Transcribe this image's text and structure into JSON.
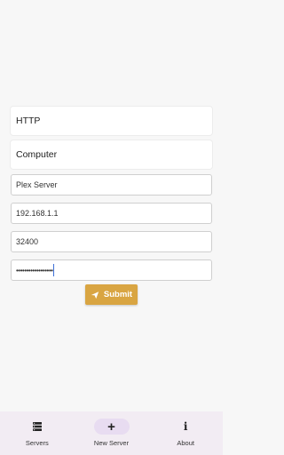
{
  "form": {
    "protocol_value": "HTTP",
    "type_value": "Computer",
    "name_value": "Plex Server",
    "ip_value": "192.168.1.1",
    "port_value": "32400",
    "password_mask": "••••••••••••••••••"
  },
  "submit": {
    "label": "Submit",
    "icon": "send-icon",
    "color": "#d9a542"
  },
  "bottom_nav": {
    "active": "New Server",
    "items": [
      {
        "label": "Servers",
        "icon": "servers-icon"
      },
      {
        "label": "New Server",
        "icon": "plus-icon"
      },
      {
        "label": "About",
        "icon": "info-icon"
      }
    ]
  }
}
